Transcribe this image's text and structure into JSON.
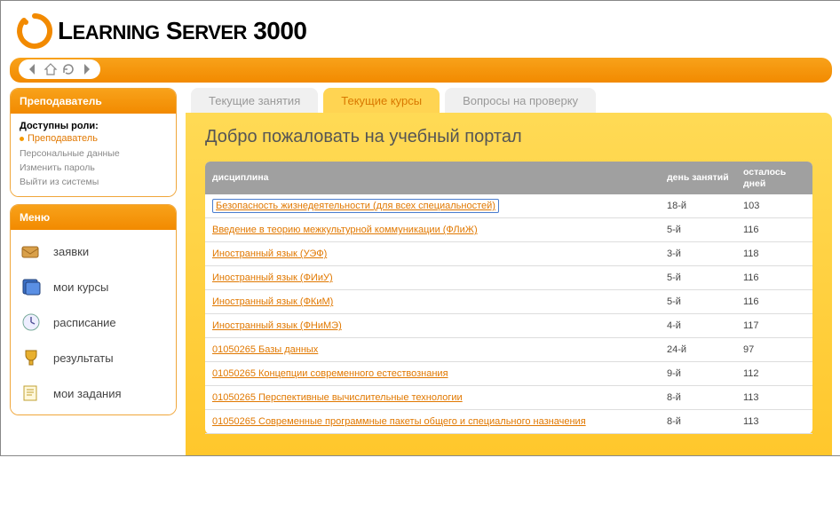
{
  "logo": {
    "text1": "L",
    "text2": "EARNING",
    "text3": " S",
    "text4": "ERVER",
    "text5": "  3000"
  },
  "sidebar": {
    "role_panel": {
      "title": "Преподаватель",
      "roles_label": "Доступны роли:",
      "role_link": "Преподаватель",
      "links": [
        "Персональные данные",
        "Изменить пароль",
        "Выйти из системы"
      ]
    },
    "menu_panel": {
      "title": "Меню",
      "items": [
        {
          "label": "заявки",
          "icon": "mailbox-icon"
        },
        {
          "label": "мои курсы",
          "icon": "books-icon"
        },
        {
          "label": "расписание",
          "icon": "clock-icon"
        },
        {
          "label": "результаты",
          "icon": "trophy-icon"
        },
        {
          "label": "мои задания",
          "icon": "notes-icon"
        }
      ]
    }
  },
  "tabs": [
    {
      "label": "Текущие занятия",
      "active": false
    },
    {
      "label": "Текущие курсы",
      "active": true
    },
    {
      "label": "Вопросы на проверку",
      "active": false
    }
  ],
  "welcome": "Добро пожаловать на учебный портал",
  "table": {
    "headers": {
      "discipline": "дисциплина",
      "day": "день занятий",
      "left": "осталось дней"
    },
    "rows": [
      {
        "name": "Безопасность жизнедеятельности (для всех специальностей)",
        "day": "18-й",
        "left": "103",
        "selected": true
      },
      {
        "name": "Введение в теорию межкультурной коммуникации (ФЛиЖ)",
        "day": "5-й",
        "left": "116"
      },
      {
        "name": "Иностранный язык (УЭФ)",
        "day": "3-й",
        "left": "118"
      },
      {
        "name": "Иностранный язык (ФИиУ)",
        "day": "5-й",
        "left": "116"
      },
      {
        "name": "Иностранный язык (ФКиМ)",
        "day": "5-й",
        "left": "116"
      },
      {
        "name": "Иностранный язык (ФНиМЭ)",
        "day": "4-й",
        "left": "117"
      },
      {
        "name": "01050265 Базы данных",
        "day": "24-й",
        "left": "97"
      },
      {
        "name": "01050265 Концепции современного естествознания",
        "day": "9-й",
        "left": "112"
      },
      {
        "name": "01050265 Перспективные вычислительные технологии",
        "day": "8-й",
        "left": "113"
      },
      {
        "name": "01050265 Современные программные пакеты общего и специального назначения",
        "day": "8-й",
        "left": "113"
      }
    ]
  }
}
